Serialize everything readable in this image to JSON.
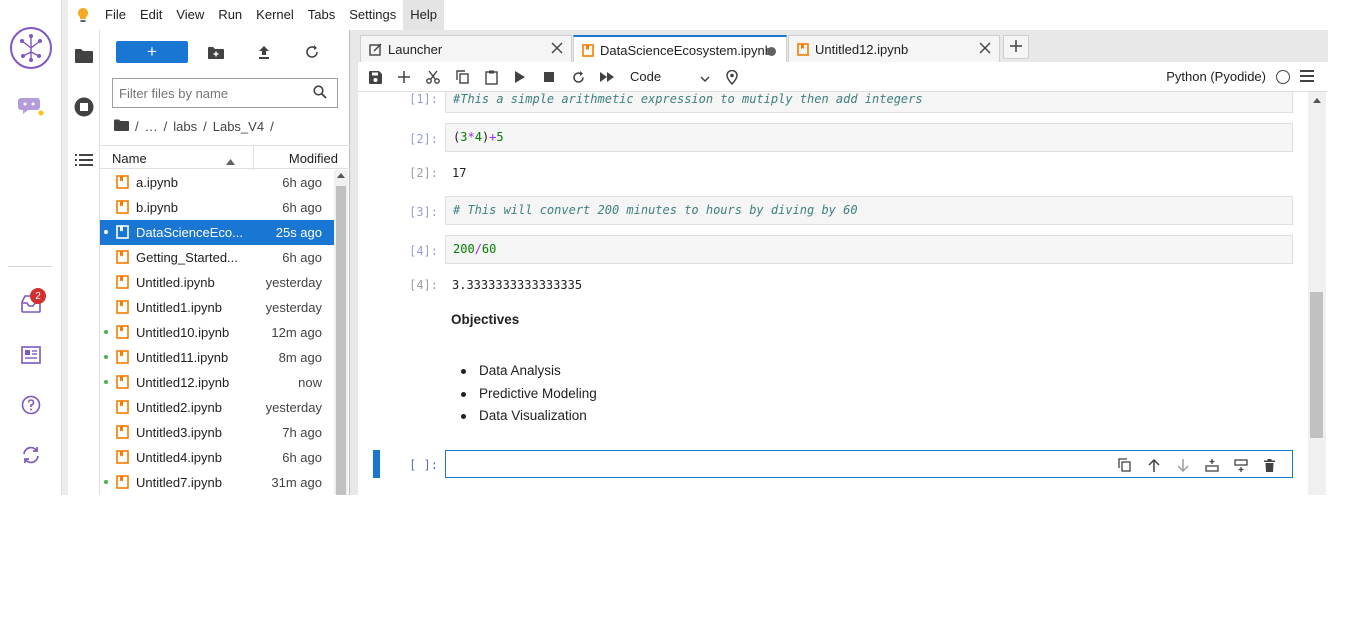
{
  "menu": {
    "items": [
      "File",
      "Edit",
      "View",
      "Run",
      "Kernel",
      "Tabs",
      "Settings",
      "Help"
    ],
    "active": "Help"
  },
  "activity": {
    "inbox_badge": "2"
  },
  "filebrowser": {
    "filter_placeholder": "Filter files by name",
    "breadcrumb": [
      "/",
      "…",
      "/",
      "labs",
      "/",
      "Labs_V4",
      "/"
    ],
    "header": {
      "name": "Name",
      "modified": "Modified"
    },
    "files": [
      {
        "name": "a.ipynb",
        "modified": "6h ago",
        "running": false,
        "selected": false
      },
      {
        "name": "b.ipynb",
        "modified": "6h ago",
        "running": false,
        "selected": false
      },
      {
        "name": "DataScienceEco...",
        "modified": "25s ago",
        "running": true,
        "selected": true
      },
      {
        "name": "Getting_Started...",
        "modified": "6h ago",
        "running": false,
        "selected": false
      },
      {
        "name": "Untitled.ipynb",
        "modified": "yesterday",
        "running": false,
        "selected": false
      },
      {
        "name": "Untitled1.ipynb",
        "modified": "yesterday",
        "running": false,
        "selected": false
      },
      {
        "name": "Untitled10.ipynb",
        "modified": "12m ago",
        "running": true,
        "selected": false
      },
      {
        "name": "Untitled11.ipynb",
        "modified": "8m ago",
        "running": true,
        "selected": false
      },
      {
        "name": "Untitled12.ipynb",
        "modified": "now",
        "running": true,
        "selected": false
      },
      {
        "name": "Untitled2.ipynb",
        "modified": "yesterday",
        "running": false,
        "selected": false
      },
      {
        "name": "Untitled3.ipynb",
        "modified": "7h ago",
        "running": false,
        "selected": false
      },
      {
        "name": "Untitled4.ipynb",
        "modified": "6h ago",
        "running": false,
        "selected": false
      },
      {
        "name": "Untitled7.ipynb",
        "modified": "31m ago",
        "running": true,
        "selected": false
      }
    ]
  },
  "tabs": [
    {
      "label": "Launcher",
      "active": false
    },
    {
      "label": "DataScienceEcosystem.ipynb",
      "active": true
    },
    {
      "label": "Untitled12.ipynb",
      "active": false
    }
  ],
  "toolbar": {
    "cell_type": "Code",
    "kernel": "Python (Pyodide)"
  },
  "cells": {
    "c1": {
      "prompt": "[1]:",
      "code": "#This a simple arithmetic expression to mutiply then add integers"
    },
    "c2": {
      "prompt": "[2]:",
      "out_prompt": "[2]:",
      "output": "17"
    },
    "c3": {
      "prompt": "[3]:",
      "code": "# This will convert 200 minutes to hours by diving by 60"
    },
    "c4": {
      "prompt": "[4]:",
      "out_prompt": "[4]:",
      "output": "3.3333333333333335"
    },
    "md": {
      "heading": "Objectives",
      "items": [
        "Data Analysis",
        "Predictive Modeling",
        "Data Visualization"
      ]
    },
    "empty": {
      "prompt": "[ ]:"
    }
  },
  "colors": {
    "accent": "#1976d2",
    "notebook_icon": "#f57c00",
    "activity_icon": "#7e57c2"
  }
}
